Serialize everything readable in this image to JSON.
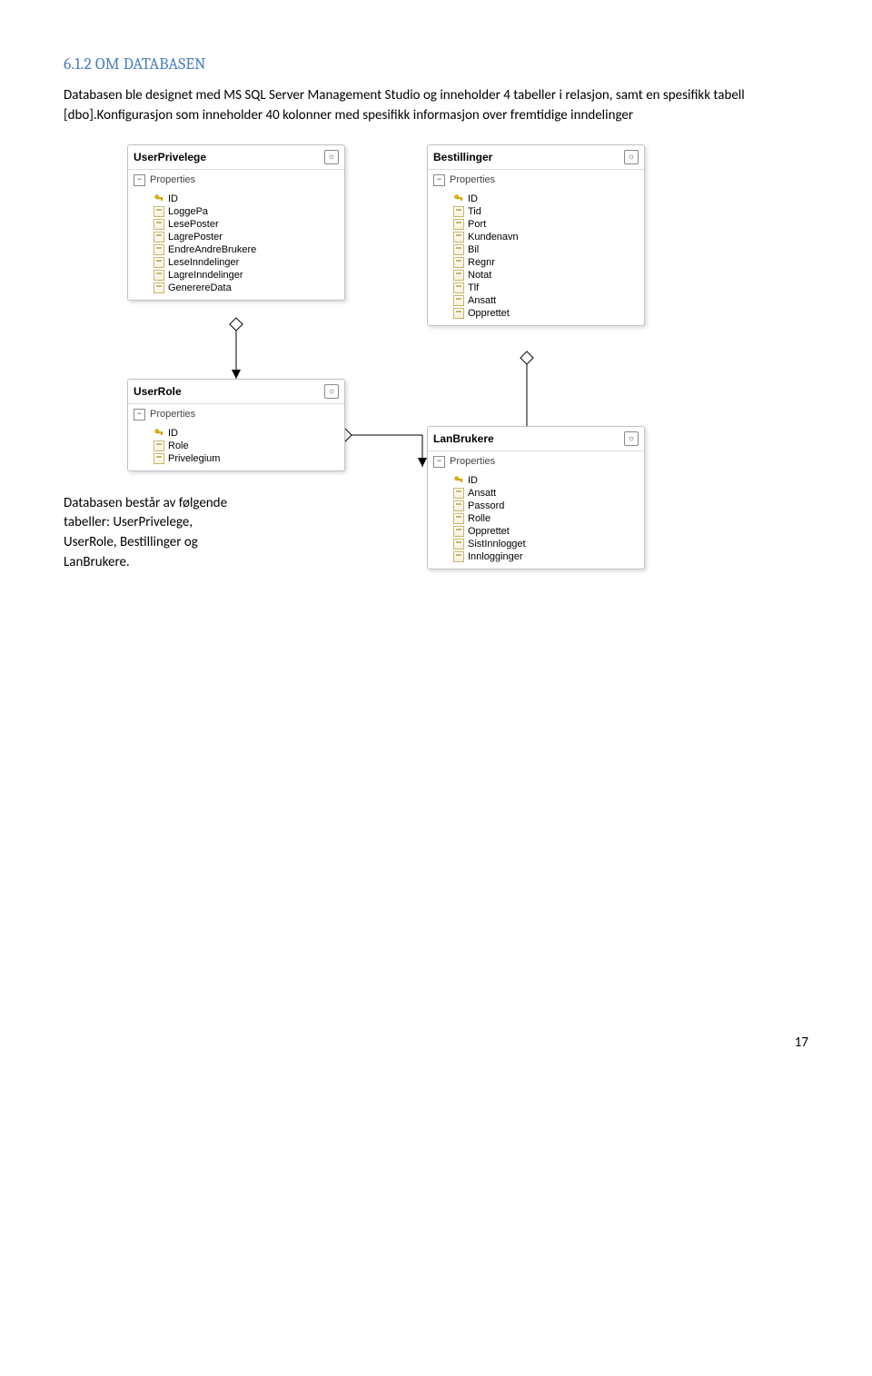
{
  "heading": "6.1.2   OM DATABASEN",
  "para1": "Databasen ble designet med MS SQL Server Management Studio og inneholder 4 tabeller i relasjon, samt en spesifikk tabell [dbo].Konfigurasjon som inneholder 40 kolonner med spesifikk informasjon over fremtidige inndelinger",
  "sideText": "Databasen består av følgende tabeller: UserPrivelege, UserRole, Bestillinger og LanBrukere.",
  "pageNumber": "17",
  "propertiesLabel": "Properties",
  "collapseGlyph": "☼",
  "minusGlyph": "−",
  "tables": {
    "userPrivelege": {
      "title": "UserPrivelege",
      "columns": [
        "ID",
        "LoggePa",
        "LesePoster",
        "LagrePoster",
        "EndreAndreBrukere",
        "LeseInndelinger",
        "LagreInndelinger",
        "GenerereData"
      ]
    },
    "bestillinger": {
      "title": "Bestillinger",
      "columns": [
        "ID",
        "Tid",
        "Port",
        "Kundenavn",
        "Bil",
        "Regnr",
        "Notat",
        "Tlf",
        "Ansatt",
        "Opprettet"
      ]
    },
    "userRole": {
      "title": "UserRole",
      "columns": [
        "ID",
        "Role",
        "Privelegium"
      ]
    },
    "lanBrukere": {
      "title": "LanBrukere",
      "columns": [
        "ID",
        "Ansatt",
        "Passord",
        "Rolle",
        "Opprettet",
        "SistInnlogget",
        "Innlogginger"
      ]
    }
  }
}
